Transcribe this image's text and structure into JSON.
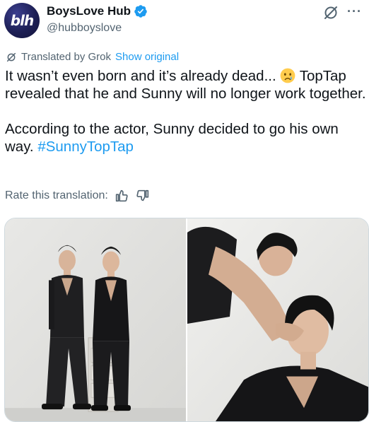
{
  "author": {
    "display_name": "BoysLove Hub",
    "handle": "@hubboyslove",
    "avatar_text": "blh",
    "verified": true
  },
  "header_actions": {
    "grok_icon": "grok-icon",
    "more_label": "···"
  },
  "translation": {
    "label": "Translated by Grok",
    "show_original": "Show original",
    "rate_label": "Rate this translation:",
    "thumbs_up_icon": "thumbs-up-icon",
    "thumbs_down_icon": "thumbs-down-icon"
  },
  "tweet": {
    "line1_before_emoji": "It wasn’t even born and it’s already dead... ",
    "emoji": "crying-face-emoji",
    "line1_after_emoji": " TopTap revealed that he and Sunny will no longer work together.",
    "paragraph2": "According to the actor, Sunny decided to go his own way. ",
    "hashtag": "#SunnyTopTap"
  },
  "media": {
    "photos": [
      {
        "label": "photo-1",
        "description_icon": "photo-two-men-standing"
      },
      {
        "label": "photo-2",
        "description_icon": "photo-two-men-closeup"
      }
    ]
  },
  "colors": {
    "accent": "#1d9bf0",
    "text": "#0f1419",
    "muted": "#536471",
    "border": "#cfd9de"
  }
}
